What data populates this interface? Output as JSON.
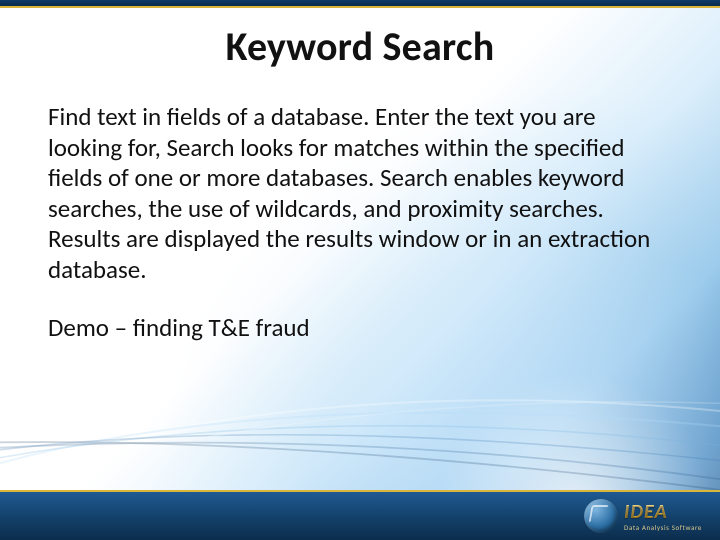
{
  "title": "Keyword Search",
  "paragraph1": "Find text in fields of a database.  Enter the text you are looking for, Search looks for matches within the specified fields of one or more databases.   Search enables keyword searches, the use of wildcards, and proximity searches.  Results are displayed the results window or in an extraction database.",
  "paragraph2": "Demo – finding T&E fraud",
  "logo": {
    "name": "IDEA",
    "sub": "Data Analysis Software"
  }
}
